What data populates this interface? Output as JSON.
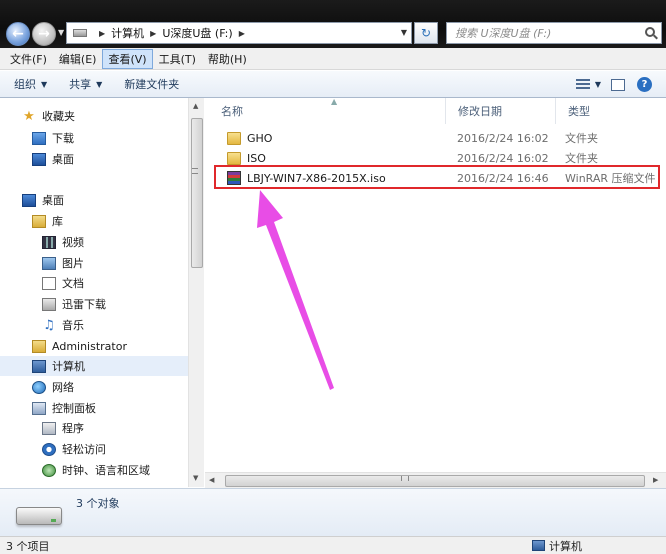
{
  "address_bar": {
    "breadcrumbs": [
      "计算机",
      "U深度U盘 (F:)"
    ],
    "search_placeholder": "搜索 U深度U盘 (F:)"
  },
  "menu": {
    "items": [
      "文件(F)",
      "编辑(E)",
      "查看(V)",
      "工具(T)",
      "帮助(H)"
    ],
    "active_index": 2
  },
  "command_bar": {
    "organize": "组织",
    "share": "共享",
    "new_folder": "新建文件夹"
  },
  "nav_pane": {
    "items": [
      {
        "label": "收藏夹",
        "icon": "star-icon",
        "indent": 0
      },
      {
        "label": "下载",
        "icon": "download-folder-icon",
        "indent": 1
      },
      {
        "label": "桌面",
        "icon": "desktop-icon",
        "indent": 1
      },
      {
        "label": "桌面",
        "icon": "desktop-icon",
        "indent": 0
      },
      {
        "label": "库",
        "icon": "library-icon",
        "indent": 1
      },
      {
        "label": "视频",
        "icon": "video-icon",
        "indent": 2
      },
      {
        "label": "图片",
        "icon": "pictures-icon",
        "indent": 2
      },
      {
        "label": "文档",
        "icon": "document-icon",
        "indent": 2
      },
      {
        "label": "迅雷下载",
        "icon": "download-icon",
        "indent": 2
      },
      {
        "label": "音乐",
        "icon": "music-icon",
        "indent": 2
      },
      {
        "label": "Administrator",
        "icon": "user-folder-icon",
        "indent": 1
      },
      {
        "label": "计算机",
        "icon": "computer-icon",
        "indent": 1
      },
      {
        "label": "网络",
        "icon": "network-icon",
        "indent": 1
      },
      {
        "label": "控制面板",
        "icon": "control-panel-icon",
        "indent": 1
      },
      {
        "label": "程序",
        "icon": "programs-icon",
        "indent": 2
      },
      {
        "label": "轻松访问",
        "icon": "ease-of-access-icon",
        "indent": 2
      },
      {
        "label": "时钟、语言和区域",
        "icon": "clock-icon",
        "indent": 2
      }
    ]
  },
  "columns": {
    "name": "名称",
    "date": "修改日期",
    "type": "类型"
  },
  "files": [
    {
      "name": "GHO",
      "date": "2016/2/24 16:02",
      "type": "文件夹",
      "icon": "folder-icon"
    },
    {
      "name": "ISO",
      "date": "2016/2/24 16:02",
      "type": "文件夹",
      "icon": "folder-icon"
    },
    {
      "name": "LBJY-WIN7-X86-2015X.iso",
      "date": "2016/2/24 16:46",
      "type": "WinRAR 压缩文件",
      "icon": "winrar-archive-icon"
    }
  ],
  "details": {
    "object_count": "3 个对象"
  },
  "status": {
    "left": "3 个项目",
    "right": "计算机"
  },
  "colors": {
    "highlight_box": "#e0282b",
    "annotation_arrow": "#e84de6"
  }
}
